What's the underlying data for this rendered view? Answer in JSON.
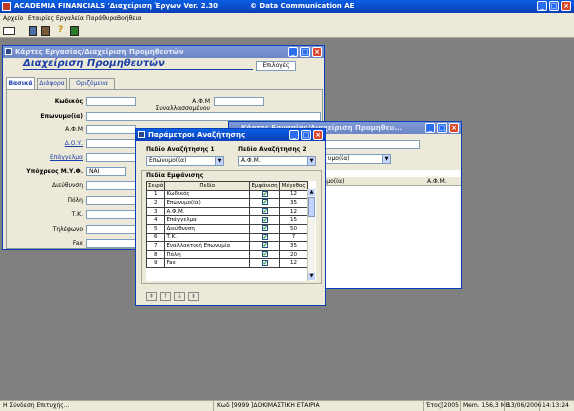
{
  "app": {
    "title": "ACADEMIA FINANCIALS 'Διαχείριση Έργων Ver. 2.30",
    "copyright": "© Data Communication AE"
  },
  "menu": [
    "Αρχείο",
    "Εταιρίες",
    "Εργαλεία",
    "Παράθυρα",
    "Βοήθεια"
  ],
  "win_main": {
    "title": "Κάρτες Εργασίας/Διαχείριση Προμηθευτών",
    "heading": "Διαχείριση Προμηθευτών",
    "options_button": "Επιλογές",
    "tabs": [
      "Βασικά",
      "Διάφορα",
      "Οριζόμενα Πεδία"
    ],
    "fields": {
      "code": "Κωδικός",
      "afm_counterparty": "Α.Φ.Μ Συναλλασσομένου",
      "name": "Επωνυμο(ία)",
      "afm": "Α.Φ.Μ",
      "doy": "Δ.Ο.Υ.",
      "profession": "Επάγγελμα",
      "myf": "Υπόχρεος Μ.Υ.Φ.",
      "myf_value": "ΝΑΙ",
      "address": "Διεύθυνση",
      "city": "Πόλη",
      "zip": "Τ.Κ.",
      "phone": "Τηλέφωνο",
      "fax": "Fax"
    }
  },
  "win_search": {
    "title": "Κάρτες Εργασίας/Διαχείριση Προμηθευ...",
    "select_value": "υμο(ία)",
    "col1": "Επωνυμο(ία)",
    "col2": "Α.Φ.Μ."
  },
  "dialog": {
    "title": "Παράμετροι Αναζήτησης",
    "field1_label": "Πεδίο Αναζήτησης 1",
    "field1_value": "Επώνυμο(ία)",
    "field2_label": "Πεδίο Αναζήτησης 2",
    "field2_value": "Α.Φ.Μ.",
    "display_label": "Πεδία Εμφάνισης",
    "columns": [
      "Σειρά",
      "Πεδίο",
      "Εμφάνιση",
      "Μέγεθος"
    ],
    "rows": [
      {
        "order": "1",
        "field": "Κωδικός",
        "size": "12"
      },
      {
        "order": "2",
        "field": "Επώνυμο(ία)",
        "size": "35"
      },
      {
        "order": "3",
        "field": "Α.Φ.Μ.",
        "size": "12"
      },
      {
        "order": "4",
        "field": "Επάγγελμα",
        "size": "15"
      },
      {
        "order": "5",
        "field": "Διεύθυνση",
        "size": "50"
      },
      {
        "order": "6",
        "field": "Τ.Κ.",
        "size": "7"
      },
      {
        "order": "7",
        "field": "Εναλλακτική Επωνυμία",
        "size": "35"
      },
      {
        "order": "8",
        "field": "Πόλη",
        "size": "20"
      },
      {
        "order": "9",
        "field": "Fax",
        "size": "12"
      }
    ]
  },
  "status": {
    "left": "Η Σύνδεση Επιτυχής...",
    "company": "Κωδ [9999 ]ΔΟΚΙΜΑΣΤΙΚΗ ΕΤΑΙΡΙΑ",
    "year": "Έτος[2005",
    "memory": "Mem. 156,3 MB",
    "date": "13/06/2006",
    "time": "14:13:24"
  }
}
